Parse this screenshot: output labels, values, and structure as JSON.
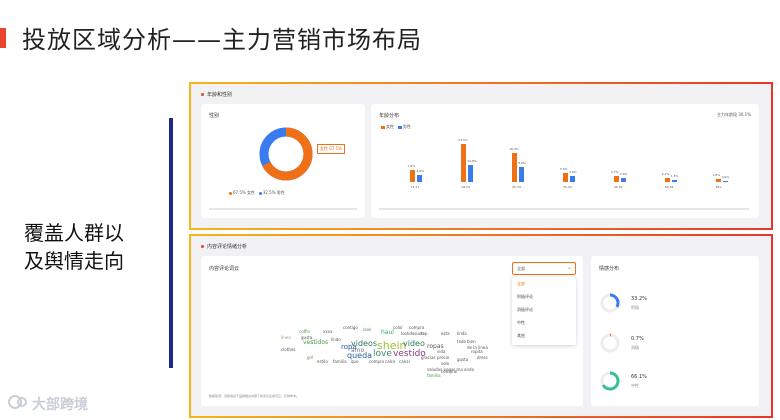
{
  "page": {
    "title": "投放区域分析——主力营销市场布局",
    "side_text_line1": "覆盖人群以",
    "side_text_line2": "及舆情走向",
    "watermark": "大部跨境"
  },
  "panel_top": {
    "section_label": "年龄和性别",
    "gender": {
      "title": "性别",
      "donut_label": "女性 67.5%",
      "legend": [
        "67.5% 女性",
        "32.5% 男性"
      ],
      "female_pct": 67.5,
      "male_pct": 32.5,
      "colors": {
        "female": "#f07018",
        "male": "#3a7cf0"
      }
    },
    "age": {
      "title": "年龄分布",
      "summary": "主力年龄段 30.1%",
      "legend": [
        "女性",
        "男性"
      ],
      "categories": [
        "13-17",
        "18-24",
        "25-34",
        "35-44",
        "45-54",
        "55-64",
        "65+"
      ],
      "bar_labels_f": [
        "7.8%",
        "23.5%",
        "18.4%",
        "5.5%",
        "3.7%",
        "2.2%",
        "1.8%"
      ],
      "bar_labels_m": [
        "4.6%",
        "10.8%",
        "9.6%",
        "4.0%",
        "2.6%",
        "1.5%",
        "0.9%"
      ],
      "values_f": [
        7.8,
        23.5,
        18.4,
        5.5,
        3.7,
        2.2,
        1.8
      ],
      "values_m": [
        4.6,
        10.8,
        9.6,
        4.0,
        2.6,
        1.5,
        0.9
      ]
    }
  },
  "panel_bottom": {
    "section_label": "内容评论情绪分析",
    "cloud": {
      "title": "内容评论词云",
      "select_value": "全部",
      "dropdown": [
        "全部",
        "积极评论",
        "消极评论",
        "中性",
        "其他"
      ],
      "footnote": "数据来源：该模块基于品牌相关内容下的评论生成词云，仅供参考。",
      "words": [
        {
          "t": "coffin",
          "c": "#4a9a48",
          "s": 4
        },
        {
          "t": "xxxx",
          "c": "#555",
          "s": 4
        },
        {
          "t": "contigo",
          "c": "#555",
          "s": 4
        },
        {
          "t": "look",
          "c": "#4a9a48",
          "s": 4
        },
        {
          "t": "color",
          "c": "#555",
          "s": 4
        },
        {
          "t": "compra",
          "c": "#555",
          "s": 4
        },
        {
          "t": "linea",
          "c": "#8a7",
          "s": 4
        },
        {
          "t": "gusta",
          "c": "#555",
          "s": 4
        },
        {
          "t": "lindo",
          "c": "#555",
          "s": 4
        },
        {
          "t": "haul",
          "c": "#3a6",
          "s": 6
        },
        {
          "t": "lookdesuen",
          "c": "#555",
          "s": 4
        },
        {
          "t": "top",
          "c": "#555",
          "s": 4
        },
        {
          "t": "esta",
          "c": "#555",
          "s": 4
        },
        {
          "t": "linda",
          "c": "#555",
          "s": 4
        },
        {
          "t": "vestidos",
          "c": "#4a9a48",
          "s": 6
        },
        {
          "t": "ropa",
          "c": "#2a5a9a",
          "s": 7
        },
        {
          "t": "videos",
          "c": "#2a7a5a",
          "s": 8
        },
        {
          "t": "shein",
          "c": "#9ac030",
          "s": 11
        },
        {
          "t": "video",
          "c": "#2a7a5a",
          "s": 8
        },
        {
          "t": "ropas",
          "c": "#555",
          "s": 6
        },
        {
          "t": "amo",
          "c": "#777",
          "s": 6
        },
        {
          "t": "queda",
          "c": "#2a5a9a",
          "s": 8
        },
        {
          "t": "love",
          "c": "#3a8a6a",
          "s": 9
        },
        {
          "t": "vestido",
          "c": "#8a3a8a",
          "s": 9
        },
        {
          "t": "todo",
          "c": "#555",
          "s": 4
        },
        {
          "t": "bien",
          "c": "#555",
          "s": 4
        },
        {
          "t": "de la linea",
          "c": "#555",
          "s": 4
        },
        {
          "t": "vida",
          "c": "#555",
          "s": 4
        },
        {
          "t": "precio",
          "c": "#555",
          "s": 4
        },
        {
          "t": "solo",
          "c": "#555",
          "s": 4
        },
        {
          "t": "comprar",
          "c": "#555",
          "s": 4
        },
        {
          "t": "ropita",
          "c": "#555",
          "s": 4
        },
        {
          "t": "dress",
          "c": "#555",
          "s": 4
        },
        {
          "t": "gusta",
          "c": "#555",
          "s": 4
        },
        {
          "t": "clothes",
          "c": "#555",
          "s": 4
        },
        {
          "t": "girl",
          "c": "#4a9a48",
          "s": 4
        },
        {
          "t": "estilo",
          "c": "#555",
          "s": 4
        },
        {
          "t": "familia",
          "c": "#555",
          "s": 4
        },
        {
          "t": "que",
          "c": "#555",
          "s": 4
        },
        {
          "t": "compro",
          "c": "#555",
          "s": 4
        },
        {
          "t": "calce",
          "c": "#555",
          "s": 4
        },
        {
          "t": "canal",
          "c": "#555",
          "s": 4
        },
        {
          "t": "gracias",
          "c": "#555",
          "s": 4
        },
        {
          "t": "saludos pegar ma ando",
          "c": "#555",
          "s": 4
        },
        {
          "t": "familia",
          "c": "#4a9a48",
          "s": 4
        }
      ]
    },
    "sentiment": {
      "title": "情感分布",
      "items": [
        {
          "pct": "33.2%",
          "label": "积极",
          "value": 33.2,
          "color": "#3a7cf0"
        },
        {
          "pct": "0.7%",
          "label": "消极",
          "value": 0.7,
          "color": "#f07018"
        },
        {
          "pct": "66.1%",
          "label": "中性",
          "value": 66.1,
          "color": "#3ac090"
        }
      ]
    }
  }
}
